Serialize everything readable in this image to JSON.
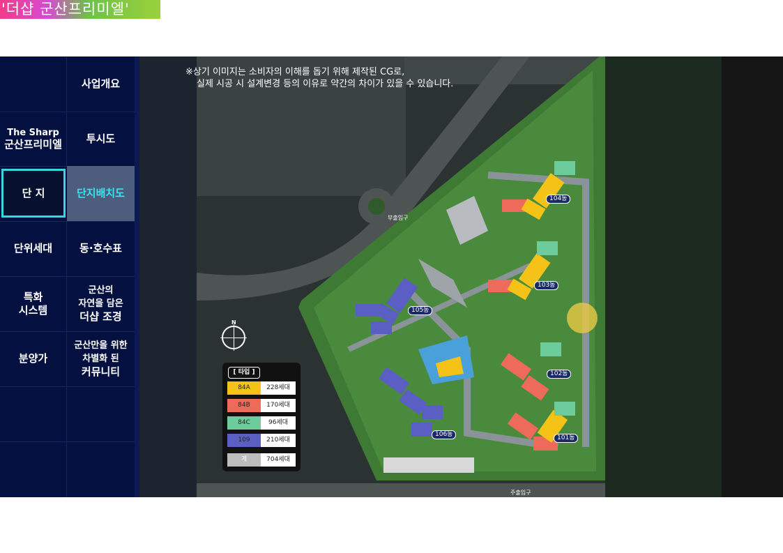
{
  "brand": "'더샵 군산프리미엘'",
  "nav": {
    "rows": [
      {
        "left": "",
        "right": "사업개요"
      },
      {
        "left_top": "The Sharp",
        "left_bottom": "군산프리미엘",
        "right": "투시도"
      },
      {
        "left": "단 지",
        "right": "단지배치도"
      },
      {
        "left": "단위세대",
        "right": "동·호수표"
      },
      {
        "left_top": "특화",
        "left_bottom": "시스템",
        "right_1": "군산의",
        "right_2": "자연을 담은",
        "right_3": "더샵 조경"
      },
      {
        "left": "분양가",
        "right_1": "군산만을 위한",
        "right_2": "차별화 된",
        "right_3": "커뮤니티"
      }
    ]
  },
  "map": {
    "notice_line1": "※상기 이미지는 소비자의 이해를 돕기 위해 제작된 CG로,",
    "notice_line2": "실제 시공 시 설계변경 등의 이유로 약간의 차이가 있을 수 있습니다.",
    "buildings": [
      "104동",
      "103동",
      "105동",
      "102동",
      "106동",
      "101동"
    ],
    "labels": {
      "entrance_top": "부출입구",
      "entrance_bottom": "주출입구",
      "compass_n": "N"
    },
    "legend": {
      "title": "[ 타입 ]",
      "rows": [
        {
          "type": "84A",
          "count": "228세대",
          "color": "#f5c318"
        },
        {
          "type": "84B",
          "count": "170세대",
          "color": "#ee6a5a"
        },
        {
          "type": "84C",
          "count": "96세대",
          "color": "#6dcc9c"
        },
        {
          "type": "109",
          "count": "210세대",
          "color": "#5b5fc4"
        },
        {
          "type": "계",
          "count": "704세대",
          "color": "#bdbdbd"
        }
      ]
    }
  }
}
